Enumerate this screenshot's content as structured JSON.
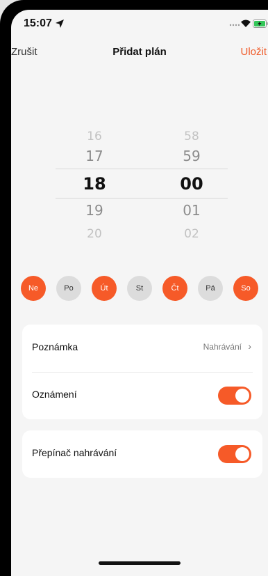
{
  "status_bar": {
    "time": "15:07"
  },
  "nav": {
    "cancel": "Zrušit",
    "title": "Přidat plán",
    "save": "Uložit"
  },
  "picker": {
    "hours": [
      "16",
      "17",
      "18",
      "19",
      "20"
    ],
    "minutes": [
      "58",
      "59",
      "00",
      "01",
      "02"
    ],
    "selected_hour": "18",
    "selected_minute": "00"
  },
  "days": [
    {
      "label": "Ne",
      "active": true
    },
    {
      "label": "Po",
      "active": false
    },
    {
      "label": "Út",
      "active": true
    },
    {
      "label": "St",
      "active": false
    },
    {
      "label": "Čt",
      "active": true
    },
    {
      "label": "Pá",
      "active": false
    },
    {
      "label": "So",
      "active": true
    }
  ],
  "settings": {
    "note_label": "Poznámka",
    "note_value": "Nahrávání",
    "notify_label": "Oznámení",
    "notify_on": true,
    "record_switch_label": "Přepínač nahrávání",
    "record_switch_on": true
  },
  "colors": {
    "accent": "#f65a28",
    "background": "#f5f5f5"
  }
}
